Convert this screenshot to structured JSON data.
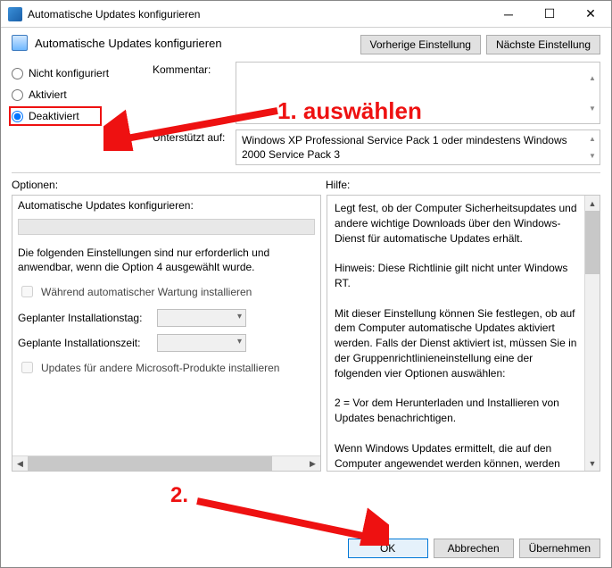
{
  "window": {
    "title": "Automatische Updates konfigurieren"
  },
  "header": {
    "policy_title": "Automatische Updates konfigurieren",
    "prev_btn": "Vorherige Einstellung",
    "next_btn": "Nächste Einstellung"
  },
  "radios": {
    "not_configured": "Nicht konfiguriert",
    "enabled": "Aktiviert",
    "disabled": "Deaktiviert",
    "selected": "disabled"
  },
  "labels": {
    "comment": "Kommentar:",
    "supported_on": "Unterstützt auf:",
    "options": "Optionen:",
    "help": "Hilfe:"
  },
  "supported_text": "Windows XP Professional Service Pack 1 oder mindestens Windows 2000 Service Pack 3",
  "options_pane": {
    "title": "Automatische Updates konfigurieren:",
    "note": "Die folgenden Einstellungen sind nur erforderlich und anwendbar, wenn die Option 4 ausgewählt wurde.",
    "chk_maintenance": "Während automatischer Wartung installieren",
    "install_day": "Geplanter Installationstag:",
    "install_time": "Geplante Installationszeit:",
    "chk_other_ms": "Updates für andere Microsoft-Produkte installieren"
  },
  "help_text": "Legt fest, ob der Computer Sicherheitsupdates und andere wichtige Downloads über den Windows-Dienst für automatische Updates erhält.\n\nHinweis: Diese Richtlinie gilt nicht unter Windows RT.\n\nMit dieser Einstellung können Sie festlegen, ob auf dem Computer automatische Updates aktiviert werden. Falls der Dienst aktiviert ist, müssen Sie in der Gruppenrichtlinieneinstellung eine der folgenden vier Optionen auswählen:\n\n    2 = Vor dem Herunterladen und Installieren von Updates benachrichtigen.\n\n    Wenn Windows Updates ermittelt, die auf den Computer angewendet werden können, werden Benutzer darüber informiert, dass Updates heruntergeladen werden können. Unter Windows Update können Benutzer alle verfügbaren Updates herunterladen und installieren.",
  "footer": {
    "ok": "OK",
    "cancel": "Abbrechen",
    "apply": "Übernehmen"
  },
  "annotations": {
    "step1": "1. auswählen",
    "step2": "2."
  }
}
